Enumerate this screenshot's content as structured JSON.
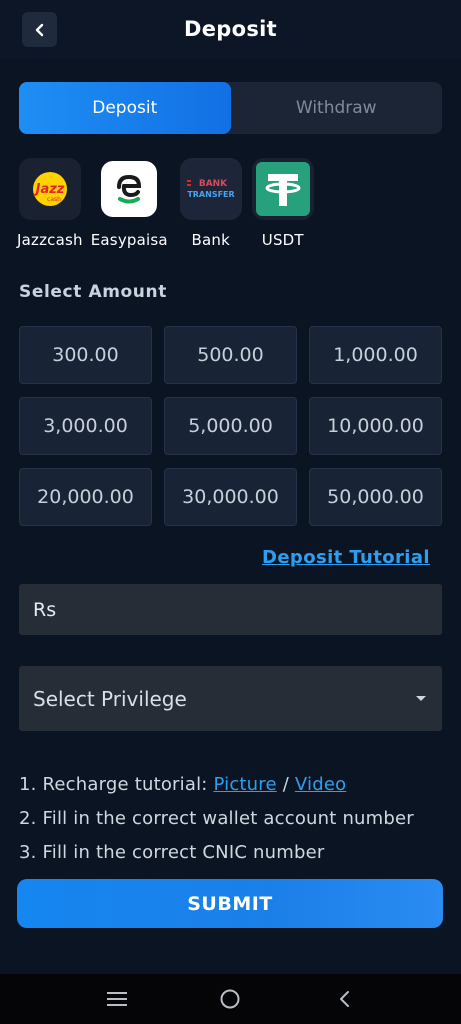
{
  "header": {
    "title": "Deposit",
    "back_icon": "chevron-left-icon"
  },
  "tabs": [
    {
      "label": "Deposit",
      "active": true
    },
    {
      "label": "Withdraw",
      "active": false
    }
  ],
  "payment_methods": [
    {
      "label": "Jazzcash",
      "icon": "jazz-logo-icon",
      "icon_text": "Jazz",
      "icon_subtext": "cash"
    },
    {
      "label": "Easypaisa",
      "icon": "easypaisa-logo-icon"
    },
    {
      "label": "Bank",
      "icon": "bank-transfer-icon",
      "icon_text_1": "BANK",
      "icon_text_2": "TRANSFER"
    },
    {
      "label": "USDT",
      "icon": "tether-logo-icon"
    }
  ],
  "select_amount_title": "Select Amount",
  "amounts": [
    "300.00",
    "500.00",
    "1,000.00",
    "3,000.00",
    "5,000.00",
    "10,000.00",
    "20,000.00",
    "30,000.00",
    "50,000.00"
  ],
  "tutorial_link": "Deposit Tutorial",
  "amount_input": {
    "value": "Rs"
  },
  "privilege_select": {
    "value": "Select Privilege"
  },
  "instructions": {
    "line1_prefix": "1. Recharge tutorial: ",
    "picture_link": "Picture",
    "separator": " / ",
    "video_link": "Video",
    "line2": "2. Fill in the correct wallet account number",
    "line3": "3. Fill in the correct CNIC number"
  },
  "submit_label": "SUBMIT",
  "system_nav": [
    "menu-icon",
    "home-circle-icon",
    "back-icon"
  ],
  "colors": {
    "background": "#0b1422",
    "accent": "#1e8ef4",
    "link": "#2e9ff0",
    "card": "#182335",
    "input": "#272d36",
    "easypaisa_green": "#1aaa55",
    "tether_green": "#26a17b",
    "jazz_red": "#e3222a",
    "jazz_yellow": "#ffd200"
  }
}
